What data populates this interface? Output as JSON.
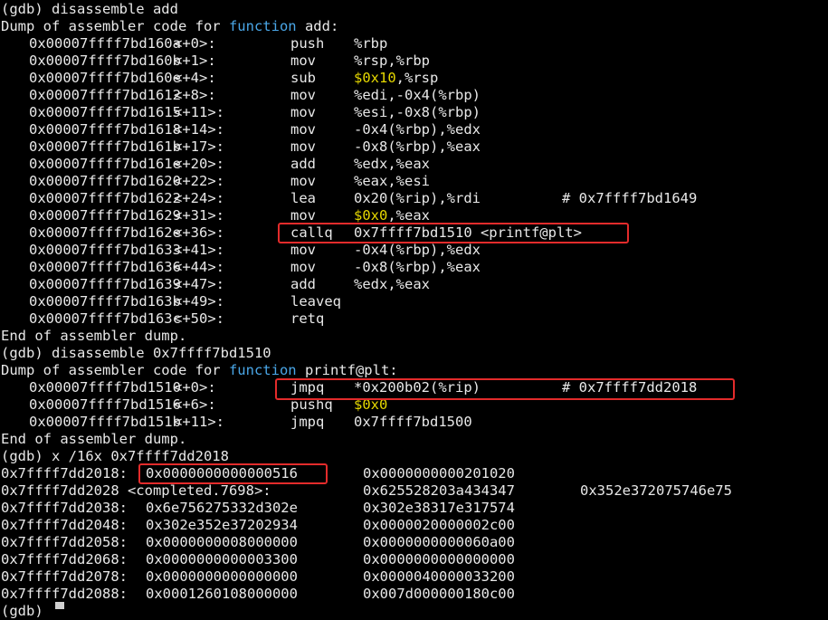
{
  "terminal": {
    "line1": "(gdb) disassemble add",
    "dump_prefix": "Dump of assembler code for ",
    "dump_keyword": "function",
    "dump_add_suffix": " add:",
    "add_asm": [
      {
        "addr": "0x00007ffff7bd160a",
        "off": "<+0>:",
        "op": "push",
        "arg_pre": "%rbp",
        "imm": "",
        "arg_post": "",
        "comment": ""
      },
      {
        "addr": "0x00007ffff7bd160b",
        "off": "<+1>:",
        "op": "mov",
        "arg_pre": "%rsp,%rbp",
        "imm": "",
        "arg_post": "",
        "comment": ""
      },
      {
        "addr": "0x00007ffff7bd160e",
        "off": "<+4>:",
        "op": "sub",
        "arg_pre": "",
        "imm": "$0x10",
        "arg_post": ",%rsp",
        "comment": ""
      },
      {
        "addr": "0x00007ffff7bd1612",
        "off": "<+8>:",
        "op": "mov",
        "arg_pre": "%edi,-0x4(%rbp)",
        "imm": "",
        "arg_post": "",
        "comment": ""
      },
      {
        "addr": "0x00007ffff7bd1615",
        "off": "<+11>:",
        "op": "mov",
        "arg_pre": "%esi,-0x8(%rbp)",
        "imm": "",
        "arg_post": "",
        "comment": ""
      },
      {
        "addr": "0x00007ffff7bd1618",
        "off": "<+14>:",
        "op": "mov",
        "arg_pre": "-0x4(%rbp),%edx",
        "imm": "",
        "arg_post": "",
        "comment": ""
      },
      {
        "addr": "0x00007ffff7bd161b",
        "off": "<+17>:",
        "op": "mov",
        "arg_pre": "-0x8(%rbp),%eax",
        "imm": "",
        "arg_post": "",
        "comment": ""
      },
      {
        "addr": "0x00007ffff7bd161e",
        "off": "<+20>:",
        "op": "add",
        "arg_pre": "%edx,%eax",
        "imm": "",
        "arg_post": "",
        "comment": ""
      },
      {
        "addr": "0x00007ffff7bd1620",
        "off": "<+22>:",
        "op": "mov",
        "arg_pre": "%eax,%esi",
        "imm": "",
        "arg_post": "",
        "comment": ""
      },
      {
        "addr": "0x00007ffff7bd1622",
        "off": "<+24>:",
        "op": "lea",
        "arg_pre": "0x20(%rip),%rdi",
        "imm": "",
        "arg_post": "",
        "comment": "# 0x7ffff7bd1649"
      },
      {
        "addr": "0x00007ffff7bd1629",
        "off": "<+31>:",
        "op": "mov",
        "arg_pre": "",
        "imm": "$0x0",
        "arg_post": ",%eax",
        "comment": ""
      },
      {
        "addr": "0x00007ffff7bd162e",
        "off": "<+36>:",
        "op": "callq",
        "arg_pre": "0x7ffff7bd1510 <printf@plt>",
        "imm": "",
        "arg_post": "",
        "comment": ""
      },
      {
        "addr": "0x00007ffff7bd1633",
        "off": "<+41>:",
        "op": "mov",
        "arg_pre": "-0x4(%rbp),%edx",
        "imm": "",
        "arg_post": "",
        "comment": ""
      },
      {
        "addr": "0x00007ffff7bd1636",
        "off": "<+44>:",
        "op": "mov",
        "arg_pre": "-0x8(%rbp),%eax",
        "imm": "",
        "arg_post": "",
        "comment": ""
      },
      {
        "addr": "0x00007ffff7bd1639",
        "off": "<+47>:",
        "op": "add",
        "arg_pre": "%edx,%eax",
        "imm": "",
        "arg_post": "",
        "comment": ""
      },
      {
        "addr": "0x00007ffff7bd163b",
        "off": "<+49>:",
        "op": "leaveq",
        "arg_pre": "",
        "imm": "",
        "arg_post": "",
        "comment": ""
      },
      {
        "addr": "0x00007ffff7bd163c",
        "off": "<+50>:",
        "op": "retq",
        "arg_pre": "",
        "imm": "",
        "arg_post": "",
        "comment": ""
      }
    ],
    "end_dump": "End of assembler dump.",
    "line2": "(gdb) disassemble 0x7ffff7bd1510",
    "dump_plt_suffix": " printf@plt:",
    "plt_asm": [
      {
        "addr": "0x00007ffff7bd1510",
        "off": "<+0>:",
        "op": "jmpq",
        "arg_pre": "*0x200b02(%rip)",
        "imm": "",
        "arg_post": "",
        "comment": "# 0x7ffff7dd2018"
      },
      {
        "addr": "0x00007ffff7bd1516",
        "off": "<+6>:",
        "op": "pushq",
        "arg_pre": "",
        "imm": "$0x0",
        "arg_post": "",
        "comment": ""
      },
      {
        "addr": "0x00007ffff7bd151b",
        "off": "<+11>:",
        "op": "jmpq",
        "arg_pre": "0x7ffff7bd1500",
        "imm": "",
        "arg_post": "",
        "comment": ""
      }
    ],
    "line3": "(gdb) x /16x 0x7ffff7dd2018",
    "mem": [
      {
        "label": "0x7ffff7dd2018:",
        "v1": "0x0000000000000516",
        "v2": "0x0000000000201020",
        "v3": ""
      },
      {
        "label": "0x7ffff7dd2028 <completed.7698>:",
        "v1": "",
        "v2": "0x625528203a434347",
        "v3": "0x352e372075746e75"
      },
      {
        "label": "0x7ffff7dd2038:",
        "v1": "0x6e756275332d302e",
        "v2": "0x302e38317e317574",
        "v3": ""
      },
      {
        "label": "0x7ffff7dd2048:",
        "v1": "0x302e352e37202934",
        "v2": "0x0000020000002c00",
        "v3": ""
      },
      {
        "label": "0x7ffff7dd2058:",
        "v1": "0x0000000008000000",
        "v2": "0x0000000000060a00",
        "v3": ""
      },
      {
        "label": "0x7ffff7dd2068:",
        "v1": "0x0000000000003300",
        "v2": "0x0000000000000000",
        "v3": ""
      },
      {
        "label": "0x7ffff7dd2078:",
        "v1": "0x0000000000000000",
        "v2": "0x0000040000033200",
        "v3": ""
      },
      {
        "label": "0x7ffff7dd2088:",
        "v1": "0x0001260108000000",
        "v2": "0x007d000000180c00",
        "v3": ""
      }
    ],
    "prompt": "(gdb) "
  },
  "colors": {
    "background": "#000000",
    "text": "#e8e8e8",
    "keyword": "#4aa7e8",
    "immediate": "#e6d800",
    "highlight": "#e32b2b"
  }
}
